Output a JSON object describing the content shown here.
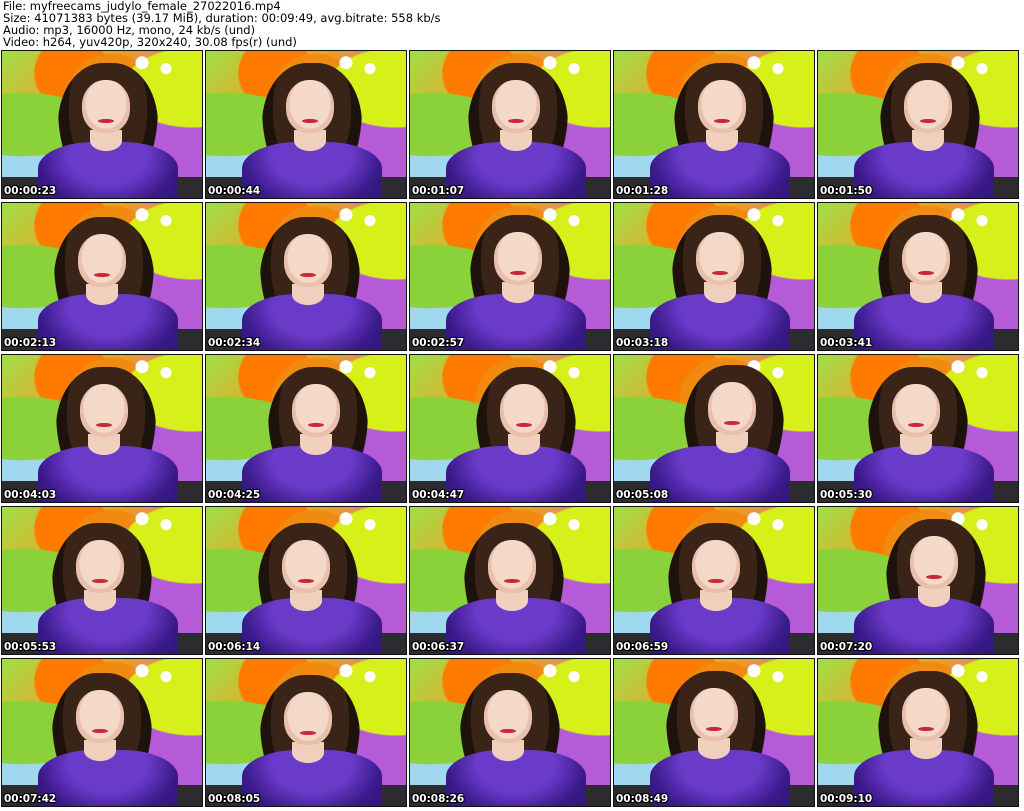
{
  "header": {
    "file_line": "File: myfreecams_judylo_female_27022016.mp4",
    "size_line": "Size: 41071383 bytes (39.17 MiB), duration: 00:09:49, avg.bitrate: 558 kb/s",
    "audio_line": "Audio: mp3, 16000 Hz, mono, 24 kb/s (und)",
    "video_line": "Video: h264, yuv420p, 320x240, 30.08 fps(r) (und)"
  },
  "thumbnails": [
    {
      "timestamp": "00:00:23"
    },
    {
      "timestamp": "00:00:44"
    },
    {
      "timestamp": "00:01:07"
    },
    {
      "timestamp": "00:01:28"
    },
    {
      "timestamp": "00:01:50"
    },
    {
      "timestamp": "00:02:13"
    },
    {
      "timestamp": "00:02:34"
    },
    {
      "timestamp": "00:02:57"
    },
    {
      "timestamp": "00:03:18"
    },
    {
      "timestamp": "00:03:41"
    },
    {
      "timestamp": "00:04:03"
    },
    {
      "timestamp": "00:04:25"
    },
    {
      "timestamp": "00:04:47"
    },
    {
      "timestamp": "00:05:08"
    },
    {
      "timestamp": "00:05:30"
    },
    {
      "timestamp": "00:05:53"
    },
    {
      "timestamp": "00:06:14"
    },
    {
      "timestamp": "00:06:37"
    },
    {
      "timestamp": "00:06:59"
    },
    {
      "timestamp": "00:07:20"
    },
    {
      "timestamp": "00:07:42"
    },
    {
      "timestamp": "00:08:05"
    },
    {
      "timestamp": "00:08:26"
    },
    {
      "timestamp": "00:08:49"
    },
    {
      "timestamp": "00:09:10"
    }
  ]
}
